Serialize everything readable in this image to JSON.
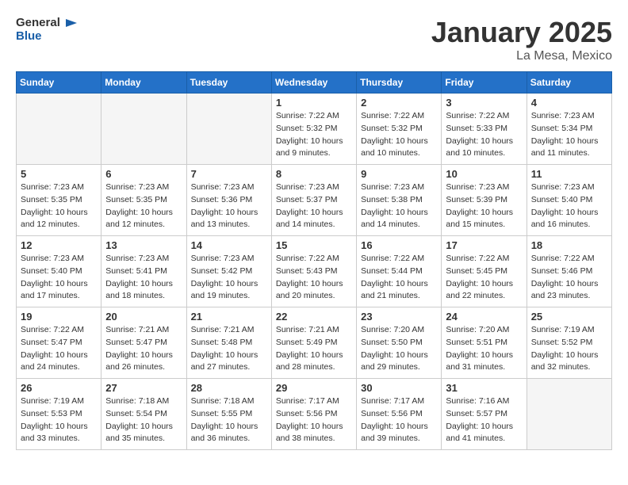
{
  "header": {
    "logo_general": "General",
    "logo_blue": "Blue",
    "month_year": "January 2025",
    "location": "La Mesa, Mexico"
  },
  "days_of_week": [
    "Sunday",
    "Monday",
    "Tuesday",
    "Wednesday",
    "Thursday",
    "Friday",
    "Saturday"
  ],
  "weeks": [
    [
      {
        "day": "",
        "info": ""
      },
      {
        "day": "",
        "info": ""
      },
      {
        "day": "",
        "info": ""
      },
      {
        "day": "1",
        "info": "Sunrise: 7:22 AM\nSunset: 5:32 PM\nDaylight: 10 hours\nand 9 minutes."
      },
      {
        "day": "2",
        "info": "Sunrise: 7:22 AM\nSunset: 5:32 PM\nDaylight: 10 hours\nand 10 minutes."
      },
      {
        "day": "3",
        "info": "Sunrise: 7:22 AM\nSunset: 5:33 PM\nDaylight: 10 hours\nand 10 minutes."
      },
      {
        "day": "4",
        "info": "Sunrise: 7:23 AM\nSunset: 5:34 PM\nDaylight: 10 hours\nand 11 minutes."
      }
    ],
    [
      {
        "day": "5",
        "info": "Sunrise: 7:23 AM\nSunset: 5:35 PM\nDaylight: 10 hours\nand 12 minutes."
      },
      {
        "day": "6",
        "info": "Sunrise: 7:23 AM\nSunset: 5:35 PM\nDaylight: 10 hours\nand 12 minutes."
      },
      {
        "day": "7",
        "info": "Sunrise: 7:23 AM\nSunset: 5:36 PM\nDaylight: 10 hours\nand 13 minutes."
      },
      {
        "day": "8",
        "info": "Sunrise: 7:23 AM\nSunset: 5:37 PM\nDaylight: 10 hours\nand 14 minutes."
      },
      {
        "day": "9",
        "info": "Sunrise: 7:23 AM\nSunset: 5:38 PM\nDaylight: 10 hours\nand 14 minutes."
      },
      {
        "day": "10",
        "info": "Sunrise: 7:23 AM\nSunset: 5:39 PM\nDaylight: 10 hours\nand 15 minutes."
      },
      {
        "day": "11",
        "info": "Sunrise: 7:23 AM\nSunset: 5:40 PM\nDaylight: 10 hours\nand 16 minutes."
      }
    ],
    [
      {
        "day": "12",
        "info": "Sunrise: 7:23 AM\nSunset: 5:40 PM\nDaylight: 10 hours\nand 17 minutes."
      },
      {
        "day": "13",
        "info": "Sunrise: 7:23 AM\nSunset: 5:41 PM\nDaylight: 10 hours\nand 18 minutes."
      },
      {
        "day": "14",
        "info": "Sunrise: 7:23 AM\nSunset: 5:42 PM\nDaylight: 10 hours\nand 19 minutes."
      },
      {
        "day": "15",
        "info": "Sunrise: 7:22 AM\nSunset: 5:43 PM\nDaylight: 10 hours\nand 20 minutes."
      },
      {
        "day": "16",
        "info": "Sunrise: 7:22 AM\nSunset: 5:44 PM\nDaylight: 10 hours\nand 21 minutes."
      },
      {
        "day": "17",
        "info": "Sunrise: 7:22 AM\nSunset: 5:45 PM\nDaylight: 10 hours\nand 22 minutes."
      },
      {
        "day": "18",
        "info": "Sunrise: 7:22 AM\nSunset: 5:46 PM\nDaylight: 10 hours\nand 23 minutes."
      }
    ],
    [
      {
        "day": "19",
        "info": "Sunrise: 7:22 AM\nSunset: 5:47 PM\nDaylight: 10 hours\nand 24 minutes."
      },
      {
        "day": "20",
        "info": "Sunrise: 7:21 AM\nSunset: 5:47 PM\nDaylight: 10 hours\nand 26 minutes."
      },
      {
        "day": "21",
        "info": "Sunrise: 7:21 AM\nSunset: 5:48 PM\nDaylight: 10 hours\nand 27 minutes."
      },
      {
        "day": "22",
        "info": "Sunrise: 7:21 AM\nSunset: 5:49 PM\nDaylight: 10 hours\nand 28 minutes."
      },
      {
        "day": "23",
        "info": "Sunrise: 7:20 AM\nSunset: 5:50 PM\nDaylight: 10 hours\nand 29 minutes."
      },
      {
        "day": "24",
        "info": "Sunrise: 7:20 AM\nSunset: 5:51 PM\nDaylight: 10 hours\nand 31 minutes."
      },
      {
        "day": "25",
        "info": "Sunrise: 7:19 AM\nSunset: 5:52 PM\nDaylight: 10 hours\nand 32 minutes."
      }
    ],
    [
      {
        "day": "26",
        "info": "Sunrise: 7:19 AM\nSunset: 5:53 PM\nDaylight: 10 hours\nand 33 minutes."
      },
      {
        "day": "27",
        "info": "Sunrise: 7:18 AM\nSunset: 5:54 PM\nDaylight: 10 hours\nand 35 minutes."
      },
      {
        "day": "28",
        "info": "Sunrise: 7:18 AM\nSunset: 5:55 PM\nDaylight: 10 hours\nand 36 minutes."
      },
      {
        "day": "29",
        "info": "Sunrise: 7:17 AM\nSunset: 5:56 PM\nDaylight: 10 hours\nand 38 minutes."
      },
      {
        "day": "30",
        "info": "Sunrise: 7:17 AM\nSunset: 5:56 PM\nDaylight: 10 hours\nand 39 minutes."
      },
      {
        "day": "31",
        "info": "Sunrise: 7:16 AM\nSunset: 5:57 PM\nDaylight: 10 hours\nand 41 minutes."
      },
      {
        "day": "",
        "info": ""
      }
    ]
  ]
}
